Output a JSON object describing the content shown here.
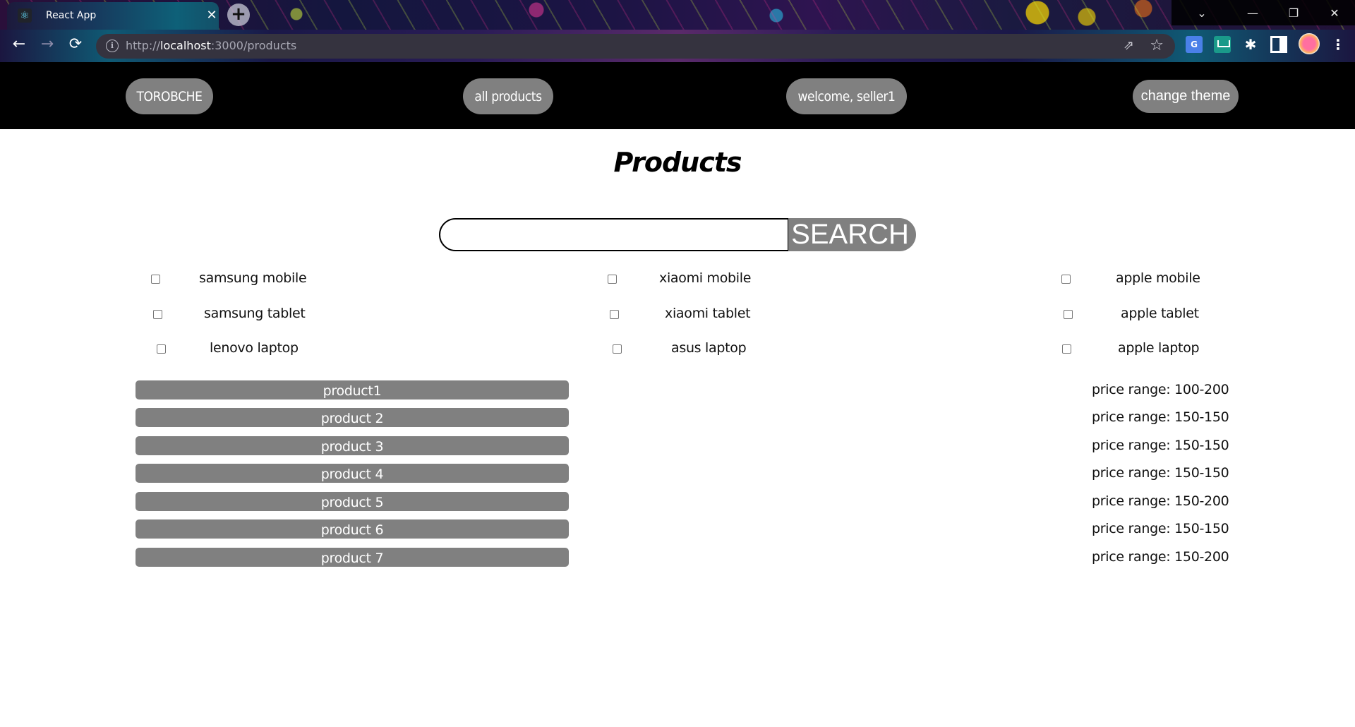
{
  "browser": {
    "tab_title": "React App",
    "tab_favicon": "react-atom-icon",
    "url_scheme": "http://",
    "url_host": "localhost",
    "url_rest": ":3000/products",
    "icons": {
      "back": "←",
      "forward": "→",
      "reload": "⟳",
      "close": "✕",
      "new_tab": "+",
      "star": "☆",
      "share": "⇗",
      "puzzle": "✱",
      "menu": "⋮",
      "translate": "G",
      "info": "i",
      "favicon": "⚛",
      "tab_search": "⌄",
      "minimize": "—",
      "restore": "❐",
      "window_close": "✕"
    }
  },
  "nav": {
    "brand": "TOROBCHE",
    "all_products": "all products",
    "welcome": "welcome, seller1",
    "change_theme": "change theme"
  },
  "page": {
    "title": "Products",
    "search": {
      "value": "",
      "placeholder": "",
      "button_label": "SEARCH"
    }
  },
  "filters": [
    {
      "label": "samsung mobile",
      "checked": false
    },
    {
      "label": "xiaomi mobile",
      "checked": false
    },
    {
      "label": "apple mobile",
      "checked": false
    },
    {
      "label": "samsung tablet",
      "checked": false
    },
    {
      "label": "xiaomi tablet",
      "checked": false
    },
    {
      "label": "apple tablet",
      "checked": false
    },
    {
      "label": "lenovo laptop",
      "checked": false
    },
    {
      "label": "asus laptop",
      "checked": false
    },
    {
      "label": "apple laptop",
      "checked": false
    }
  ],
  "products": [
    {
      "name": "product1",
      "price_range": "price range: 100-200"
    },
    {
      "name": "product 2",
      "price_range": "price range: 150-150"
    },
    {
      "name": "product 3",
      "price_range": "price range: 150-150"
    },
    {
      "name": "product 4",
      "price_range": "price range: 150-150"
    },
    {
      "name": "product 5",
      "price_range": "price range: 150-200"
    },
    {
      "name": "product 6",
      "price_range": "price range: 150-150"
    },
    {
      "name": "product 7",
      "price_range": "price range: 150-200"
    }
  ],
  "colors": {
    "nav_bg": "#000000",
    "button_bg": "#808080",
    "button_text": "#ffffff",
    "page_bg": "#ffffff"
  }
}
